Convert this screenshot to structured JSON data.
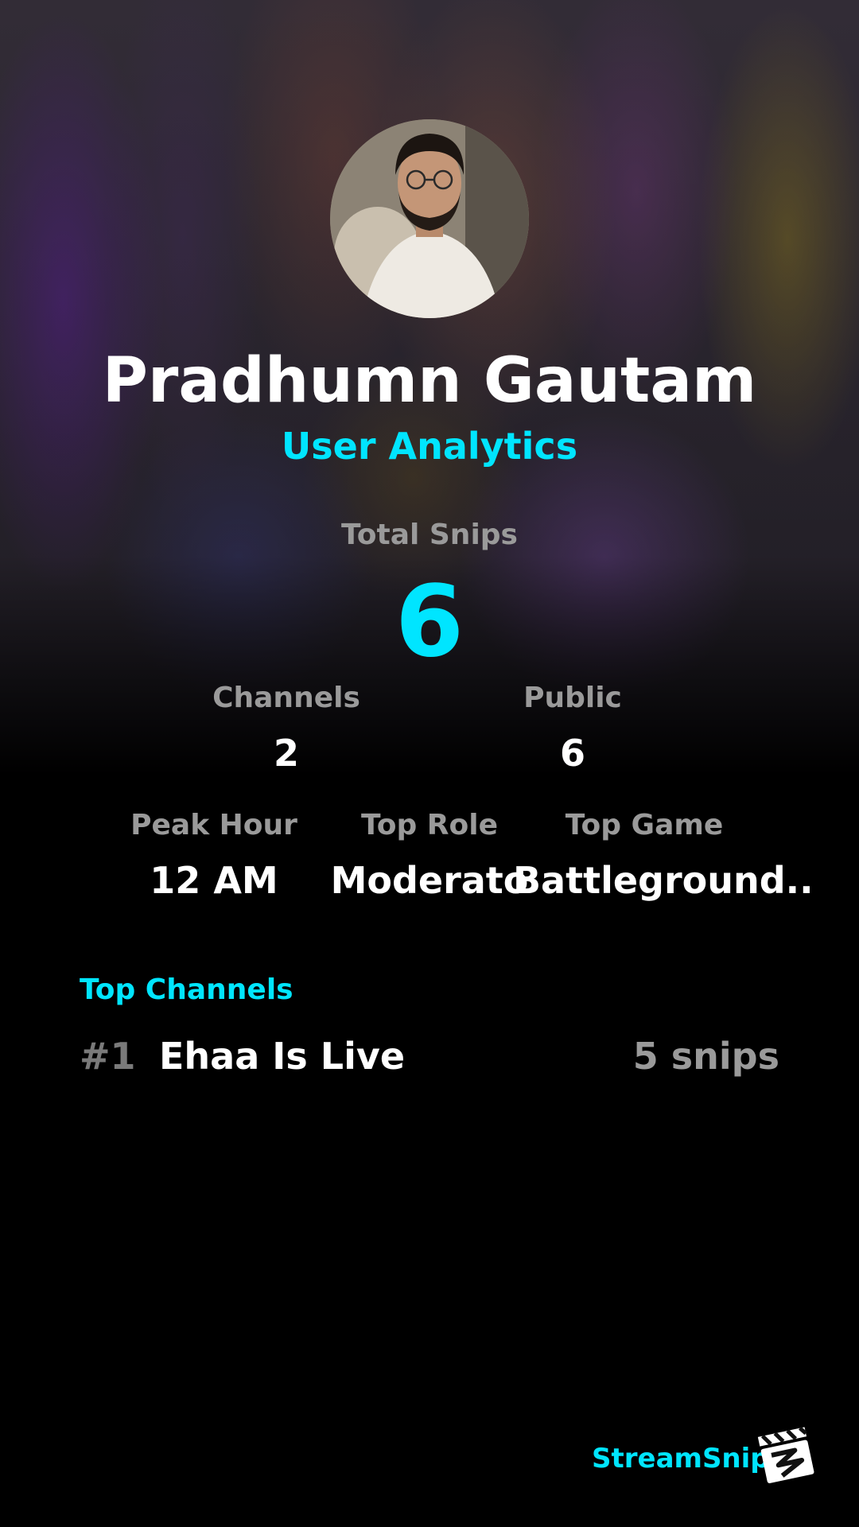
{
  "profile": {
    "name": "Pradhumn Gautam",
    "subtitle": "User Analytics",
    "avatar_icon": "user-avatar-photo"
  },
  "total": {
    "label": "Total Snips",
    "value": "6"
  },
  "stats_row1": [
    {
      "label": "Channels",
      "value": "2"
    },
    {
      "label": "Public",
      "value": "6"
    }
  ],
  "stats_row2": [
    {
      "label": "Peak Hour",
      "value": "12 AM"
    },
    {
      "label": "Top Role",
      "value": "Moderato"
    },
    {
      "label": "Top Game",
      "value": "Battleground.."
    }
  ],
  "top_channels": {
    "title": "Top Channels",
    "items": [
      {
        "rank": "#1",
        "name": "Ehaa Is Live",
        "snips": "5 snips"
      }
    ]
  },
  "footer": {
    "brand": "StreamSnip",
    "logo_icon": "clapperboard-icon"
  },
  "colors": {
    "accent": "#00e5ff",
    "muted": "#9a9a9a",
    "background": "#000000"
  }
}
